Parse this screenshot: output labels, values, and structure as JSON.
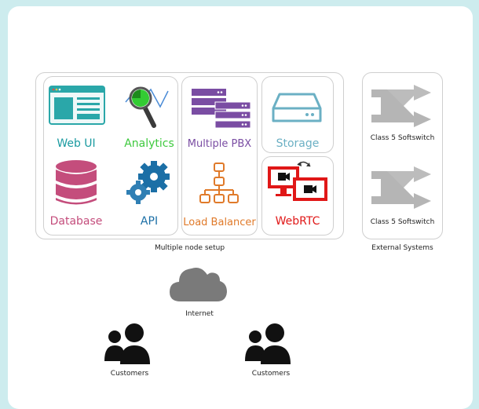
{
  "components": {
    "web_ui": {
      "label": "Web UI",
      "color": "#1a9aa0"
    },
    "analytics": {
      "label": "Analytics",
      "color": "#3ec93e"
    },
    "multiple_pbx": {
      "label": "Multiple PBX",
      "color": "#7a4da3"
    },
    "storage": {
      "label": "Storage",
      "color": "#6bb0c4"
    },
    "database": {
      "label": "Database",
      "color": "#c44d7c"
    },
    "api": {
      "label": "API",
      "color": "#1b6fa6"
    },
    "load_balancer": {
      "label": "Load Balancer",
      "color": "#e07a2a"
    },
    "webrtc": {
      "label": "WebRTC",
      "color": "#e01717"
    }
  },
  "groups": {
    "node_setup": "Multiple node setup",
    "external_systems": "External Systems"
  },
  "external": {
    "softswitch_top": "Class 5 Softswitch",
    "softswitch_bottom": "Class 5 Softswitch"
  },
  "internet": "Internet",
  "customers": [
    "Customers",
    "Customers"
  ]
}
